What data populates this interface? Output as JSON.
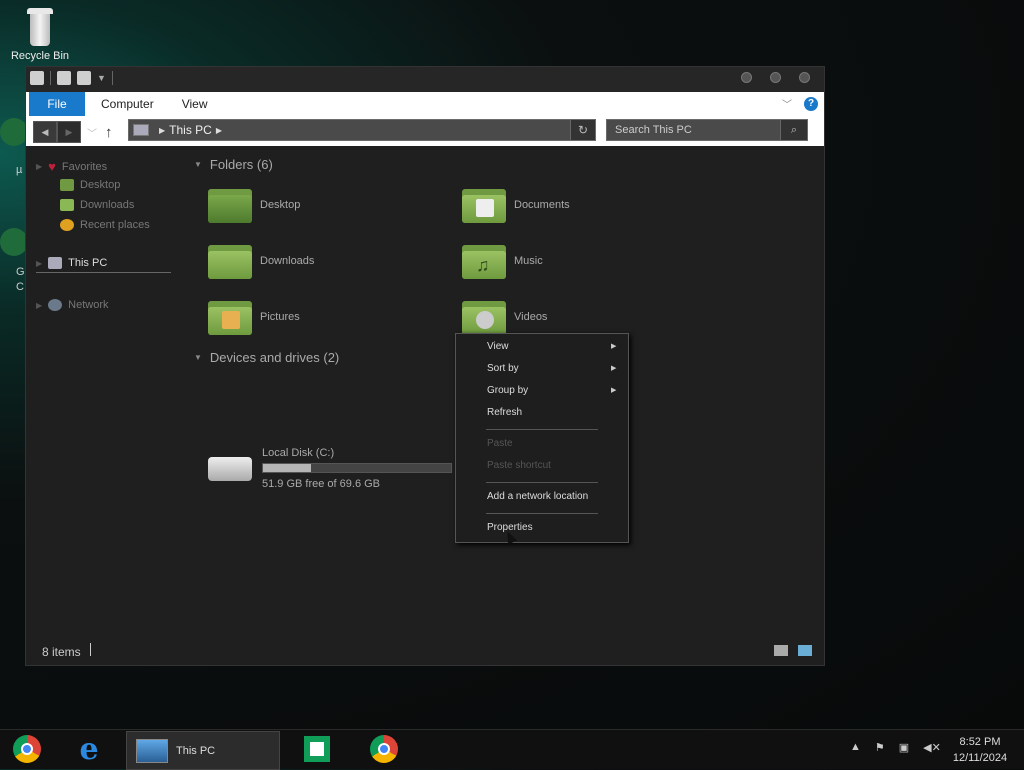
{
  "desktop": {
    "recycle_bin_label": "Recycle Bin",
    "edge_chars": [
      "µ",
      "G",
      "C"
    ]
  },
  "window": {
    "ribbon_tabs": [
      "File",
      "Computer",
      "View"
    ],
    "address": {
      "location": "This PC"
    },
    "search": {
      "placeholder": "Search This PC"
    },
    "nav_pane": {
      "favorites": "Favorites",
      "desktop": "Desktop",
      "downloads": "Downloads",
      "recent_places": "Recent places",
      "this_pc": "This PC",
      "network": "Network"
    },
    "content": {
      "folders_header": "Folders (6)",
      "folders": [
        "Desktop",
        "Documents",
        "Downloads",
        "Music",
        "Pictures",
        "Videos"
      ],
      "devices_header": "Devices and drives (2)",
      "drive": {
        "name": "Local Disk (C:)",
        "free_text": "51.9 GB free of 69.6 GB",
        "used_fraction": 0.254
      }
    },
    "status": {
      "item_count": "8 items"
    }
  },
  "context_menu": {
    "view": "View",
    "sort_by": "Sort by",
    "group_by": "Group by",
    "refresh": "Refresh",
    "paste": "Paste",
    "paste_shortcut": "Paste shortcut",
    "add_network_location": "Add a network location",
    "properties": "Properties"
  },
  "taskbar": {
    "active_window": "This PC",
    "clock_time": "8:52 PM",
    "clock_date": "12/11/2024"
  },
  "colors": {
    "accent": "#1979ca",
    "folder_green": "#8ab855",
    "window_bg": "#1f1f1f"
  }
}
